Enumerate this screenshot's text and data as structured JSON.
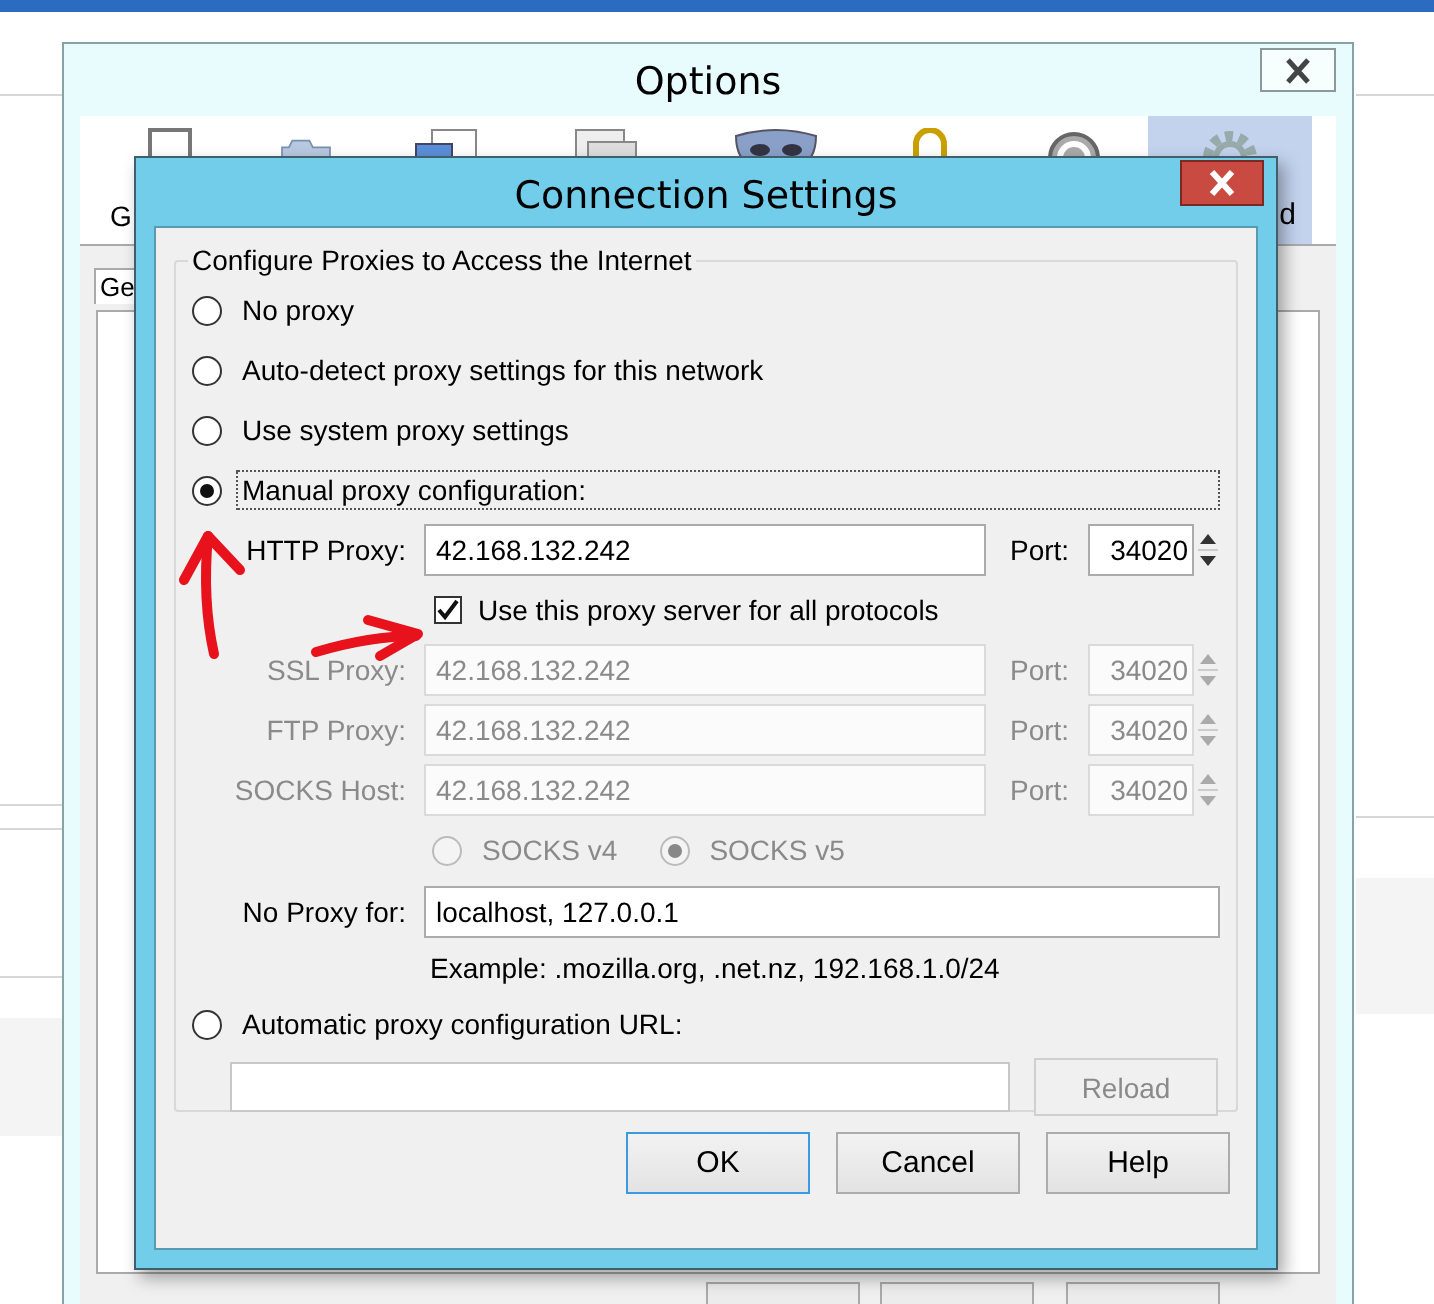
{
  "options_window": {
    "title": "Options",
    "tabs": [
      {
        "label": "G",
        "selected": false,
        "kind": "window"
      },
      {
        "selected": false,
        "kind": "tabs"
      },
      {
        "selected": false,
        "kind": "content"
      },
      {
        "selected": false,
        "kind": "apps"
      },
      {
        "selected": false,
        "kind": "mask"
      },
      {
        "selected": false,
        "kind": "lock"
      },
      {
        "selected": false,
        "kind": "sync"
      },
      {
        "label": "d",
        "selected": true,
        "kind": "gear"
      }
    ],
    "panel_tab": "Ge"
  },
  "dialog": {
    "title": "Connection Settings",
    "group_title": "Configure Proxies to Access the Internet",
    "modes": [
      {
        "label": "No proxy",
        "selected": false,
        "focused": false
      },
      {
        "label": "Auto-detect proxy settings for this network",
        "selected": false,
        "focused": false
      },
      {
        "label": "Use system proxy settings",
        "selected": false,
        "focused": false
      },
      {
        "label": "Manual proxy configuration:",
        "selected": true,
        "focused": true
      }
    ],
    "proxies": [
      {
        "label": "HTTP Proxy:",
        "value": "42.168.132.242",
        "port_label": "Port:",
        "port": "34020",
        "disabled": false
      },
      {
        "label": "SSL Proxy:",
        "value": "42.168.132.242",
        "port_label": "Port:",
        "port": "34020",
        "disabled": true
      },
      {
        "label": "FTP Proxy:",
        "value": "42.168.132.242",
        "port_label": "Port:",
        "port": "34020",
        "disabled": true
      },
      {
        "label": "SOCKS Host:",
        "value": "42.168.132.242",
        "port_label": "Port:",
        "port": "34020",
        "disabled": true
      }
    ],
    "share_all": {
      "label": "Use this proxy server for all protocols",
      "checked": true
    },
    "socks_versions": [
      {
        "label": "SOCKS v4",
        "selected": false,
        "disabled": true
      },
      {
        "label": "SOCKS v5",
        "selected": true,
        "disabled": true
      }
    ],
    "no_proxy": {
      "label": "No Proxy for:",
      "value": "localhost, 127.0.0.1"
    },
    "example": "Example: .mozilla.org, .net.nz, 192.168.1.0/24",
    "auto_config": {
      "label": "Automatic proxy configuration URL:",
      "selected": false,
      "reload": "Reload",
      "reload_disabled": true
    },
    "buttons": [
      {
        "label": "OK",
        "default": true
      },
      {
        "label": "Cancel",
        "default": false
      },
      {
        "label": "Help",
        "default": false
      }
    ]
  }
}
